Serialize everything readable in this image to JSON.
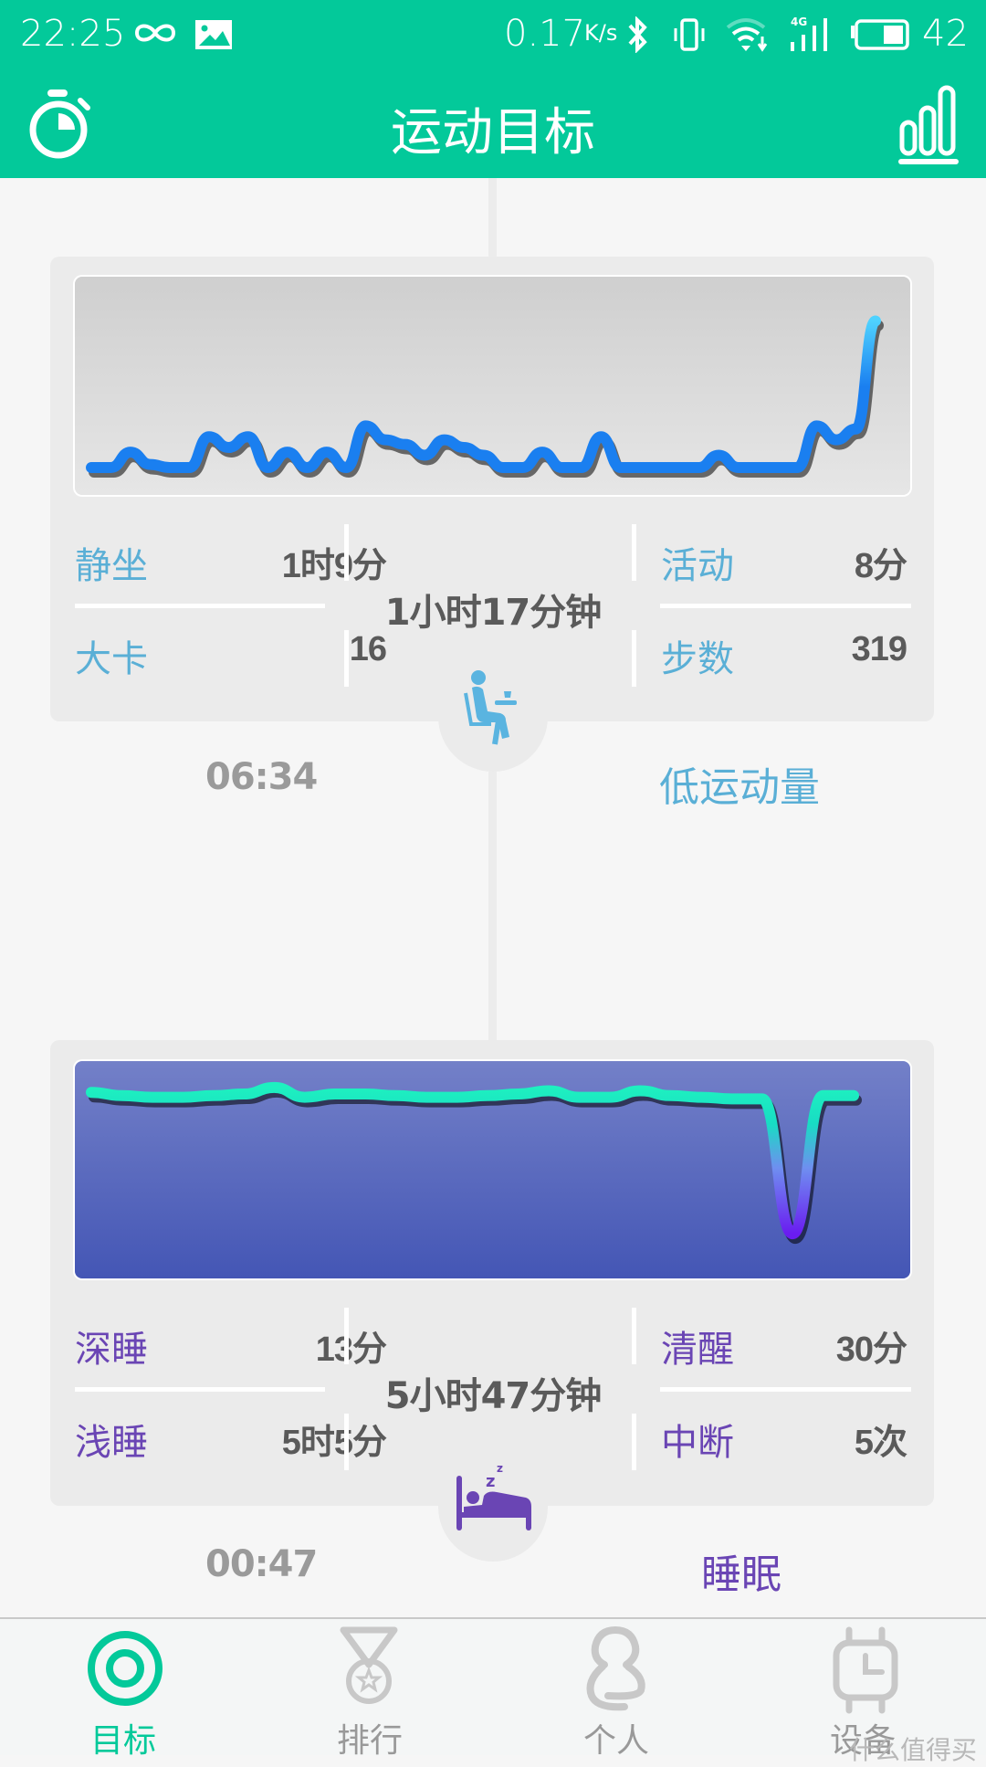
{
  "status_bar": {
    "time": "22:25",
    "net_speed": "0.17",
    "net_unit": "K/s",
    "battery": "42",
    "icons": [
      "infinity-icon",
      "image-icon",
      "bluetooth-icon",
      "vibrate-icon",
      "wifi-icon",
      "4g-signal-icon",
      "battery-icon"
    ]
  },
  "header": {
    "title": "运动目标",
    "left_icon": "stopwatch-icon",
    "right_icon": "bar-chart-icon"
  },
  "colors": {
    "brand": "#03c99a",
    "activity_accent": "#5aafd6",
    "sleep_accent": "#6a45b4",
    "activity_line": "#1a7ff0",
    "sleep_line": "#1ee8c0",
    "inactive_tab": "#c8c8c8"
  },
  "cards": [
    {
      "type": "activity",
      "stats_left": [
        {
          "label": "静坐",
          "value": "1时9分"
        },
        {
          "label": "大卡",
          "value": "16"
        }
      ],
      "total": "1小时17分钟",
      "stats_right": [
        {
          "label": "活动",
          "value": "8分"
        },
        {
          "label": "步数",
          "value": "319"
        }
      ],
      "icon": "sitting-person-icon",
      "time": "06:34",
      "kind": "低运动量"
    },
    {
      "type": "sleep",
      "stats_left": [
        {
          "label": "深睡",
          "value": "13分"
        },
        {
          "label": "浅睡",
          "value": "5时5分"
        }
      ],
      "total": "5小时47分钟",
      "stats_right": [
        {
          "label": "清醒",
          "value": "30分"
        },
        {
          "label": "中断",
          "value": "5次"
        }
      ],
      "icon": "sleeping-bed-icon",
      "time": "00:47",
      "kind": "睡眠"
    }
  ],
  "chart_data": [
    {
      "type": "line",
      "title": "",
      "xlabel": "",
      "ylabel": "",
      "grid": false,
      "ylim": [
        0,
        10
      ],
      "values": [
        0,
        0,
        1,
        0.2,
        0,
        0,
        2,
        1.3,
        2,
        0,
        1,
        0,
        1,
        0,
        2.7,
        1.8,
        1.5,
        0.8,
        1.8,
        1.3,
        0.8,
        0,
        0,
        1,
        0,
        0,
        2,
        0,
        0,
        0,
        0,
        0,
        0.8,
        0,
        0,
        0,
        0,
        2.7,
        1.8,
        2.5,
        9.5
      ]
    },
    {
      "type": "line",
      "title": "",
      "xlabel": "",
      "ylabel": "",
      "grid": false,
      "ylim": [
        0,
        10
      ],
      "values": [
        9.2,
        9.0,
        8.9,
        8.9,
        9.0,
        9.1,
        9.5,
        8.9,
        9.1,
        9.1,
        9.0,
        8.9,
        8.9,
        9.0,
        9.1,
        9.3,
        8.9,
        8.9,
        9.3,
        9.0,
        8.9,
        8.8,
        8.8,
        0.5,
        9.0,
        9.0
      ]
    }
  ],
  "bottom_nav": {
    "tabs": [
      {
        "label": "目标",
        "icon": "target-icon",
        "active": true
      },
      {
        "label": "排行",
        "icon": "medal-icon",
        "active": false
      },
      {
        "label": "个人",
        "icon": "person-icon",
        "active": false
      },
      {
        "label": "设备",
        "icon": "watch-icon",
        "active": false
      }
    ],
    "watermark": "什么值得买"
  }
}
